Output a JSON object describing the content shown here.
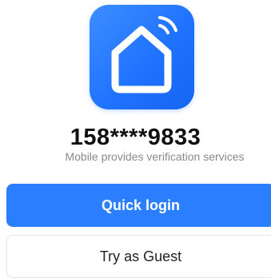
{
  "app": {
    "logo_icon": "smart-home-wifi-icon",
    "brand_color": "#2b7fff"
  },
  "login": {
    "phone_number": "158****9833",
    "provider_text": "Mobile provides verification services",
    "quick_login_label": "Quick login",
    "guest_label": "Try as Guest"
  }
}
